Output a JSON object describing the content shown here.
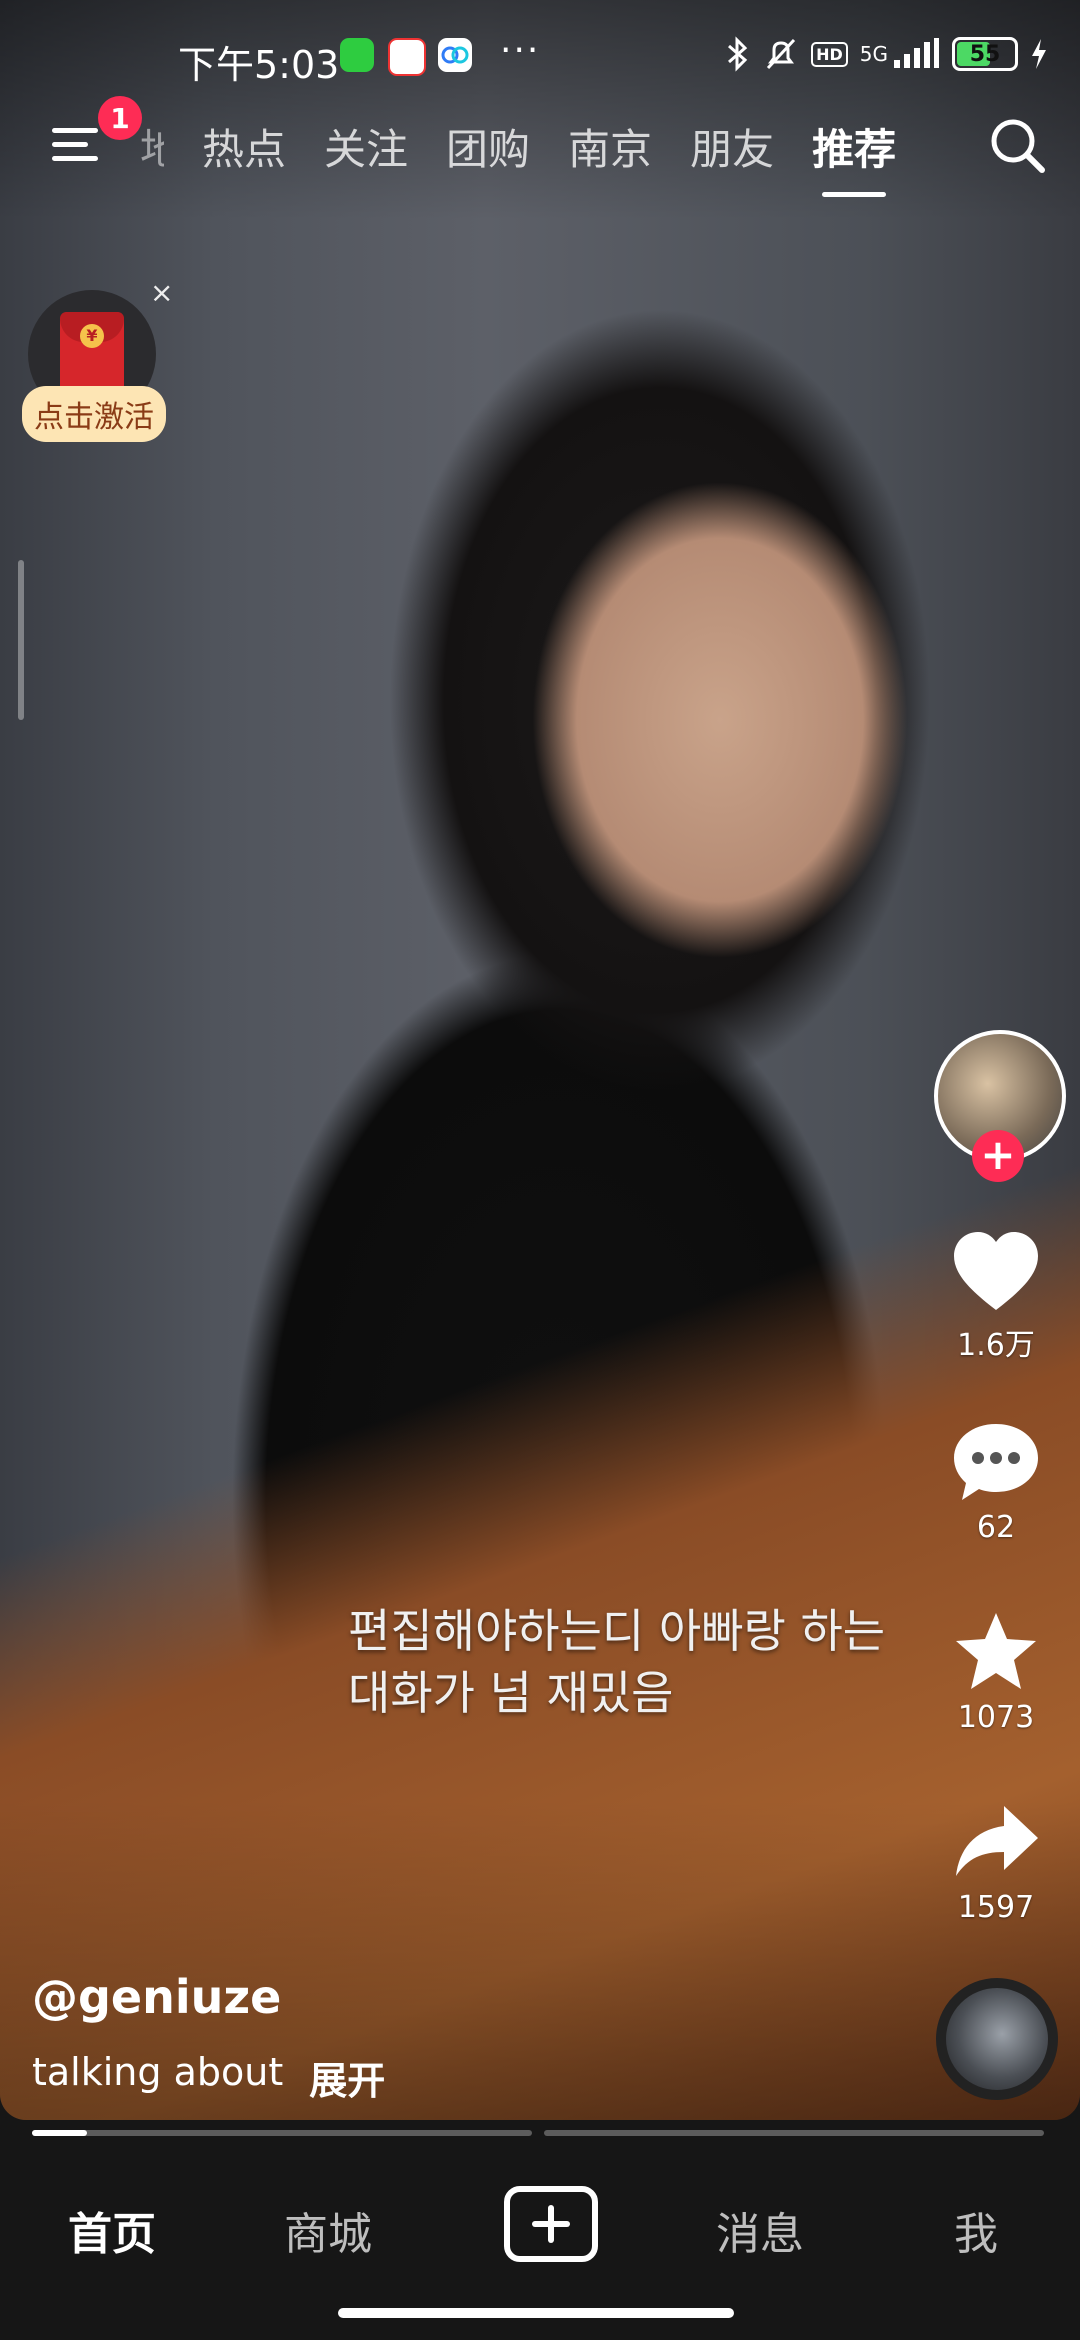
{
  "status_bar": {
    "time": "下午5:03",
    "more": "···",
    "network": "5G",
    "battery": "55",
    "battery_level": 0.55,
    "icons": [
      "wechat-icon",
      "58-app-icon",
      "baidu-netdisk-icon",
      "bluetooth-icon",
      "mute-bell-icon",
      "hd-icon",
      "signal-icon",
      "battery-icon",
      "charging-icon"
    ]
  },
  "top_nav": {
    "menu_badge": "1",
    "tabs": [
      {
        "label": "推荐"
      },
      {
        "label": "热点"
      },
      {
        "label": "关注"
      },
      {
        "label": "团购"
      },
      {
        "label": "南京"
      },
      {
        "label": "朋友"
      },
      {
        "label": "推荐"
      }
    ],
    "partial_tab": "地"
  },
  "redpacket": {
    "label": "点击激活",
    "close": "×"
  },
  "rail": {
    "likes": "1.6万",
    "comments": "62",
    "favorites": "1073",
    "shares": "1597"
  },
  "subtitle": {
    "line1": "편집해야하는디 아빠랑 하는",
    "line2": "대화가 넘 재밌음"
  },
  "author": {
    "handle": "@geniuze"
  },
  "caption": {
    "text": "talking about",
    "expand": "展开"
  },
  "progress": {
    "segment1": 0.11,
    "segment2": 0
  },
  "bottom_nav": {
    "home": "首页",
    "mall": "商城",
    "messages": "消息",
    "me": "我"
  },
  "colors": {
    "accent": "#fe2c55",
    "battery": "#4cd964"
  }
}
